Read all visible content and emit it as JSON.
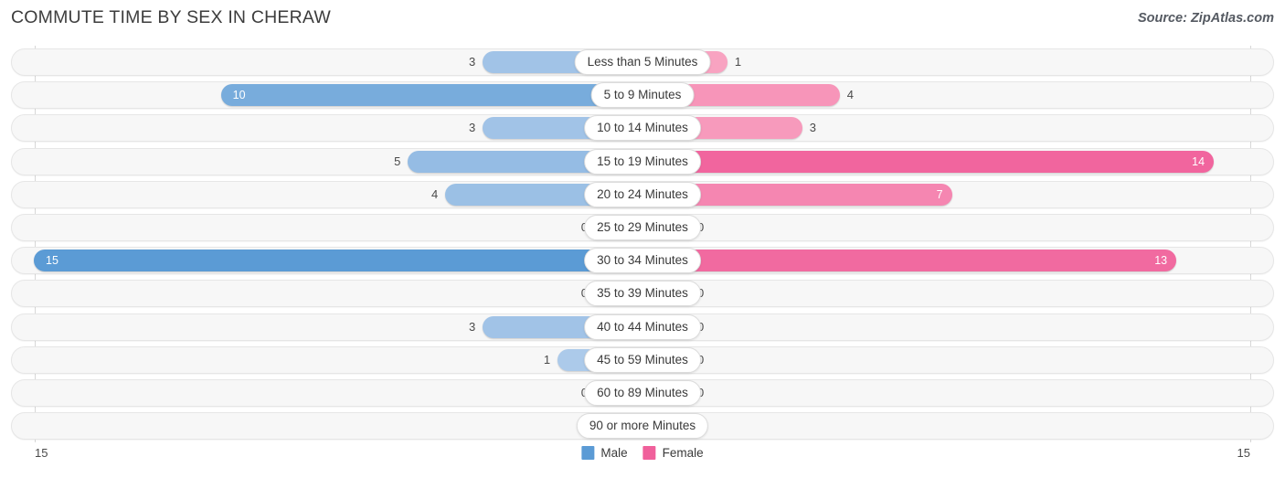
{
  "header": {
    "title": "COMMUTE TIME BY SEX IN CHERAW",
    "source": "Source: ZipAtlas.com"
  },
  "legend": {
    "male_label": "Male",
    "female_label": "Female",
    "male_color": "#5b9bd5",
    "female_color": "#f0609b"
  },
  "axis": {
    "left_max": "15",
    "right_max": "15",
    "max_value": 15
  },
  "chart_data": {
    "type": "bar",
    "orientation": "horizontal-diverging",
    "title": "COMMUTE TIME BY SEX IN CHERAW",
    "xlabel": "",
    "ylabel": "",
    "xlim": [
      15,
      15
    ],
    "grid": false,
    "legend_position": "bottom-center",
    "categories": [
      "Less than 5 Minutes",
      "5 to 9 Minutes",
      "10 to 14 Minutes",
      "15 to 19 Minutes",
      "20 to 24 Minutes",
      "25 to 29 Minutes",
      "30 to 34 Minutes",
      "35 to 39 Minutes",
      "40 to 44 Minutes",
      "45 to 59 Minutes",
      "60 to 89 Minutes",
      "90 or more Minutes"
    ],
    "series": [
      {
        "name": "Male",
        "values": [
          3,
          10,
          3,
          5,
          4,
          0,
          15,
          0,
          3,
          1,
          0,
          0
        ]
      },
      {
        "name": "Female",
        "values": [
          1,
          4,
          3,
          14,
          7,
          0,
          13,
          0,
          0,
          0,
          0,
          0
        ]
      }
    ]
  },
  "rows": [
    {
      "category": "Less than 5 Minutes",
      "male": "3",
      "female": "1",
      "male_value": 3,
      "female_value": 1
    },
    {
      "category": "5 to 9 Minutes",
      "male": "10",
      "female": "4",
      "male_value": 10,
      "female_value": 4
    },
    {
      "category": "10 to 14 Minutes",
      "male": "3",
      "female": "3",
      "male_value": 3,
      "female_value": 3
    },
    {
      "category": "15 to 19 Minutes",
      "male": "5",
      "female": "14",
      "male_value": 5,
      "female_value": 14
    },
    {
      "category": "20 to 24 Minutes",
      "male": "4",
      "female": "7",
      "male_value": 4,
      "female_value": 7
    },
    {
      "category": "25 to 29 Minutes",
      "male": "0",
      "female": "0",
      "male_value": 0,
      "female_value": 0
    },
    {
      "category": "30 to 34 Minutes",
      "male": "15",
      "female": "13",
      "male_value": 15,
      "female_value": 13
    },
    {
      "category": "35 to 39 Minutes",
      "male": "0",
      "female": "0",
      "male_value": 0,
      "female_value": 0
    },
    {
      "category": "40 to 44 Minutes",
      "male": "3",
      "female": "0",
      "male_value": 3,
      "female_value": 0
    },
    {
      "category": "45 to 59 Minutes",
      "male": "1",
      "female": "0",
      "male_value": 1,
      "female_value": 0
    },
    {
      "category": "60 to 89 Minutes",
      "male": "0",
      "female": "0",
      "male_value": 0,
      "female_value": 0
    },
    {
      "category": "90 or more Minutes",
      "male": "0",
      "female": "0",
      "male_value": 0,
      "female_value": 0
    }
  ]
}
